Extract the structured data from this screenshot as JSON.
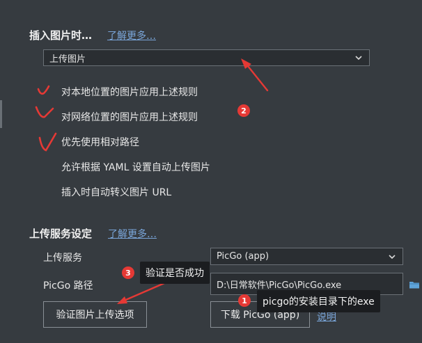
{
  "insert_section": {
    "title": "插入图片时…",
    "learn_more": "了解更多…",
    "action_select_value": "上传图片",
    "options": [
      "对本地位置的图片应用上述规则",
      "对网络位置的图片应用上述规则",
      "优先使用相对路径",
      "允许根据 YAML 设置自动上传图片",
      "插入时自动转义图片 URL"
    ]
  },
  "upload_section": {
    "title": "上传服务设定",
    "learn_more": "了解更多…",
    "service_label": "上传服务",
    "service_value": "PicGo (app)",
    "path_label": "PicGo 路径",
    "path_value": "D:\\日常软件\\PicGo\\PicGo.exe",
    "verify_button": "验证图片上传选项",
    "download_button": "下载 PicGo (app)",
    "explain_link": "说明"
  },
  "annotations": {
    "badge_1": "1",
    "badge_2": "2",
    "badge_3": "3",
    "tooltip_verify": "验证是否成功",
    "tooltip_exe": "picgo的安装目录下的exe"
  },
  "colors": {
    "background": "#363b40",
    "link": "#7aa6da",
    "annotation_red": "#e53935"
  },
  "icons": {
    "folder": "folder-icon",
    "chevron": "chevron-down-icon"
  }
}
